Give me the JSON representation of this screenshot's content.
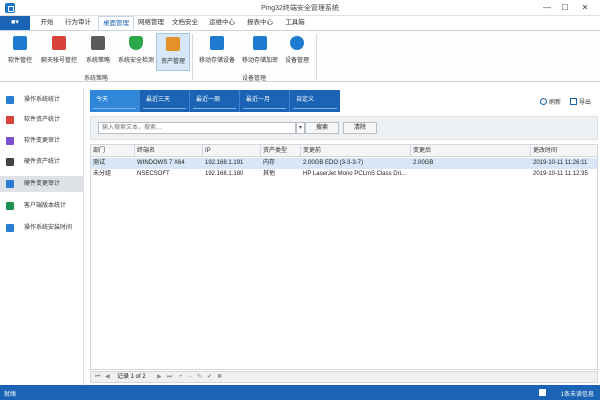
{
  "window": {
    "title": "Ping32终端安全管理系统",
    "min_glyph": "—",
    "max_glyph": "☐",
    "close_glyph": "✕",
    "menu_button_glyph": "■▾"
  },
  "menu": {
    "tabs": [
      "开始",
      "行为审计",
      "桌面管理",
      "网络管理",
      "文档安全",
      "运维中心",
      "报表中心",
      "工具箱"
    ],
    "active_index": 2
  },
  "ribbon": {
    "items": [
      {
        "label": "软件管控",
        "icon": "software-control-icon",
        "color": "#1e7bd0"
      },
      {
        "label": "聊天帐号管控",
        "icon": "chat-account-icon",
        "color": "#d9423a"
      },
      {
        "label": "系统策略",
        "icon": "tools-icon",
        "color": "#5b5b5b"
      },
      {
        "label": "系统安全检测",
        "icon": "shield-check-icon",
        "color": "#2aa84a"
      },
      {
        "label": "资产管理",
        "icon": "house-icon",
        "color": "#e2912b"
      },
      {
        "label": "移动存储设备",
        "icon": "usb-storage-icon",
        "color": "#1e7bd0"
      },
      {
        "label": "移动存储加密",
        "icon": "usb-encrypt-icon",
        "color": "#1e7bd0"
      },
      {
        "label": "设备管理",
        "icon": "bluetooth-icon",
        "color": "#1e7bd0"
      }
    ],
    "active_index": 4,
    "groups": [
      "系统策略",
      "设备管理"
    ]
  },
  "sidebar": {
    "items": [
      {
        "label": "操作系统统计",
        "icon": "windows-icon",
        "color": "#2a7fd4"
      },
      {
        "label": "软件资产统计",
        "icon": "software-icon",
        "color": "#d9423a"
      },
      {
        "label": "软件变更审计",
        "icon": "software-change-icon",
        "color": "#7a4fcf"
      },
      {
        "label": "硬件资产统计",
        "icon": "hardware-icon",
        "color": "#444444"
      },
      {
        "label": "硬件变更审计",
        "icon": "hardware-change-icon",
        "color": "#2a7fd4"
      },
      {
        "label": "客户端版本统计",
        "icon": "client-version-icon",
        "color": "#1e8f4e"
      },
      {
        "label": "操作系统安装时间",
        "icon": "install-time-icon",
        "color": "#2a7fd4"
      }
    ],
    "active_index": 4
  },
  "time_filter": {
    "options": [
      "今天",
      "最近三天",
      "最近一周",
      "最近一月",
      "自定义"
    ],
    "active_index": 0
  },
  "toolbar": {
    "refresh": "刷新",
    "export": "导出"
  },
  "search": {
    "placeholder": "输入搜索文本，搜索...",
    "dropdown_glyph": "▾",
    "search_button": "搜索",
    "clear_button": "清除"
  },
  "table": {
    "columns": [
      "部门",
      "终端名",
      "IP",
      "资产类型",
      "变更前",
      "变更后",
      "更改时间"
    ],
    "rows": [
      [
        "测试",
        "WINDOWS 7 X64",
        "192.168.1.191",
        "内存",
        "2.00GB EDO (3-3-3-7)",
        "2.00GB",
        "2019-10-11 11:26:11"
      ],
      [
        "未分组",
        "NSECSOFT",
        "192.168.1.180",
        "其他",
        "HP LaserJet Mono PCLmS Class Dri...",
        "",
        "2019-10-11 11:12:35"
      ]
    ],
    "selected_row": 0
  },
  "pager": {
    "first": "⏮",
    "prev": "◀",
    "text": "记录 1 of 2",
    "next": "▶",
    "last": "⏭",
    "add": "+",
    "remove": "−",
    "edit": "✎",
    "confirm": "✔",
    "cancel": "✖"
  },
  "status": {
    "left": "就绪",
    "right": "1条未读信息"
  },
  "colors": {
    "brand": "#1b63b5",
    "selection": "#d7e7f7"
  }
}
